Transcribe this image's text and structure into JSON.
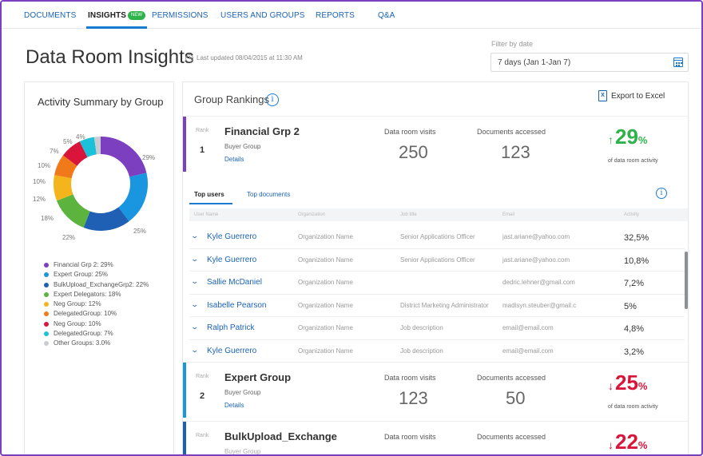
{
  "nav": {
    "items": [
      "DOCUMENTS",
      "INSIGHTS",
      "PERMISSIONS",
      "USERS AND GROUPS",
      "REPORTS",
      "Q&A"
    ],
    "new_badge": "NEW"
  },
  "header": {
    "title": "Data Room Insights",
    "last_updated": "Last updated 08/04/2015 at 11:30 AM",
    "filter_label": "Filter by date",
    "filter_value": "7 days (Jan 1-Jan 7)"
  },
  "activity": {
    "title": "Activity Summary by Group",
    "slices": [
      {
        "label": "Financial Grp 2:  29%",
        "value": 29,
        "color": "#7b3fbf"
      },
      {
        "label": "Expert Group:  25%",
        "value": 25,
        "color": "#1a96e0"
      },
      {
        "label": "BulkUpload_ExchangeGrp2:  22%",
        "value": 22,
        "color": "#1f5fb4"
      },
      {
        "label": "Expert Delegators: 18%",
        "value": 18,
        "color": "#5cb33d"
      },
      {
        "label": "Neg Group: 12%",
        "value": 12,
        "color": "#f4b51c"
      },
      {
        "label": "DelegatedGroup: 10%",
        "value": 10,
        "color": "#f07a1a"
      },
      {
        "label": "Neg Group: 10%",
        "value": 10,
        "color": "#d9153b"
      },
      {
        "label": "DelegatedGroup: 7%",
        "value": 7,
        "color": "#1cc0d8"
      },
      {
        "label": "Other Groups: 3.0%",
        "value": 3,
        "color": "#c9cdd2"
      }
    ],
    "pct_labels": [
      "29%",
      "25%",
      "22%",
      "18%",
      "12%",
      "10%",
      "10%",
      "7%",
      "5%",
      "4%"
    ]
  },
  "rankings": {
    "title": "Group Rankings",
    "export_label": "Export to Excel",
    "rank_label": "Rank",
    "visits_label": "Data room visits",
    "docs_label": "Documents accessed",
    "activity_sub": "of data room activity",
    "details_label": "Details",
    "groups": [
      {
        "rank": "1",
        "name": "Financial Grp 2",
        "type": "Buyer Group",
        "visits": "250",
        "docs": "123",
        "pct": "29",
        "dir": "up",
        "color": "#7b3fbf"
      },
      {
        "rank": "2",
        "name": "Expert Group",
        "type": "Buyer Group",
        "visits": "123",
        "docs": "50",
        "pct": "25",
        "dir": "down",
        "color": "#1a96e0"
      },
      {
        "rank": "",
        "name": "BulkUpload_Exchange",
        "type": "Buyer Group",
        "visits": "",
        "docs": "",
        "pct": "22",
        "dir": "down",
        "color": "#1f5fb4"
      }
    ],
    "pct_symbol": "%",
    "up_color": "#2db34a",
    "down_color": "#d9153b",
    "accent_color": "#1a7ad0"
  },
  "users": {
    "tabs": [
      "Top users",
      "Top documents"
    ],
    "columns": [
      "User Name",
      "Organization",
      "Job title",
      "Email",
      "Activity"
    ],
    "rows": [
      {
        "name": "Kyle Guerrero",
        "org": "Organization Name",
        "job": "Senior Applications Officer",
        "email": "jast.ariane@yahoo.com",
        "activity": "32,5%"
      },
      {
        "name": "Kyle Guerrero",
        "org": "Organization Name",
        "job": "Senior Applications Officer",
        "email": "jast.ariane@yahoo.com",
        "activity": "10,8%"
      },
      {
        "name": "Sallie McDaniel",
        "org": "Organization Name",
        "job": "",
        "email": "dedric.lehner@gmail.com",
        "activity": "7,2%"
      },
      {
        "name": "Isabelle Pearson",
        "org": "Organization Name",
        "job": "District Marketing Administrator",
        "email": "madisyn.steuber@gmail.c",
        "activity": "5%"
      },
      {
        "name": "Ralph Patrick",
        "org": "Organization Name",
        "job": "Job description",
        "email": "email@email.com",
        "activity": "4,8%"
      },
      {
        "name": "Kyle Guerrero",
        "org": "Organization Name",
        "job": "Job description",
        "email": "email@email.com",
        "activity": "3,2%"
      }
    ]
  }
}
